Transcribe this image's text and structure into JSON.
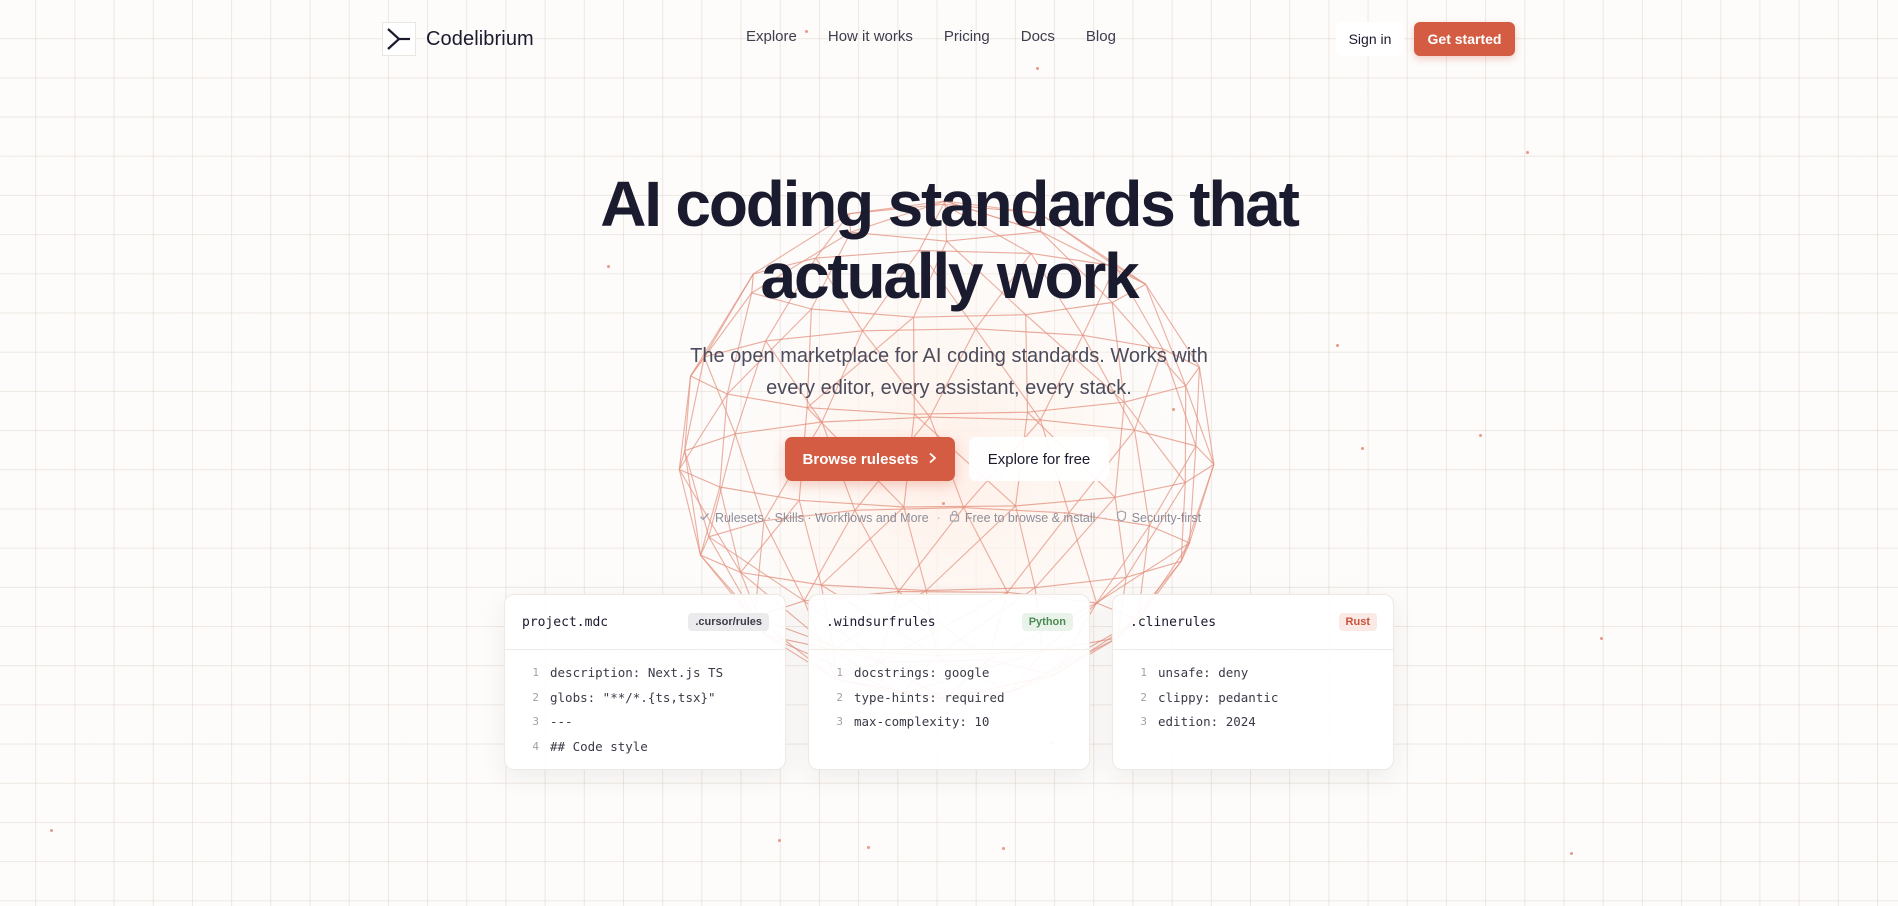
{
  "brand": {
    "name": "Codelibrium",
    "logo_icon": "chevron-bracket-logo"
  },
  "nav": {
    "links": [
      "Explore",
      "How it works",
      "Pricing",
      "Docs",
      "Blog"
    ],
    "signin_label": "Sign in",
    "cta_label": "Get started"
  },
  "hero": {
    "title_line1": "AI coding standards that",
    "title_line2": "actually work",
    "subtitle_line1": "The open marketplace for AI coding standards. Works with",
    "subtitle_line2": "every editor, every assistant, every stack.",
    "primary_cta": "Browse rulesets",
    "secondary_cta": "Explore for free",
    "features": [
      {
        "icon": "check-icon",
        "label": "Rulesets · Skills · Workflows and More"
      },
      {
        "icon": "lock-icon",
        "label": "Free to browse & install"
      },
      {
        "icon": "shield-icon",
        "label": "Security-first"
      }
    ],
    "feature_separator": "·"
  },
  "cards": [
    {
      "file": "project.mdc",
      "badge": ".cursor/rules",
      "badge_colors": {
        "bg": "#ebebed",
        "fg": "#3b3b48"
      },
      "lines": [
        {
          "n": "1",
          "code": "description: Next.js TS"
        },
        {
          "n": "2",
          "code": "globs: \"**/*.{ts,tsx}\""
        },
        {
          "n": "3",
          "code": "---"
        },
        {
          "n": "4",
          "code": "## Code style"
        }
      ]
    },
    {
      "file": ".windsurfrules",
      "badge": "Python",
      "badge_colors": {
        "bg": "#eaf3ea",
        "fg": "#4d8a55"
      },
      "lines": [
        {
          "n": "1",
          "code": "docstrings: google"
        },
        {
          "n": "2",
          "code": "type-hints: required"
        },
        {
          "n": "3",
          "code": "max-complexity: 10"
        }
      ]
    },
    {
      "file": ".clinerules",
      "badge": "Rust",
      "badge_colors": {
        "bg": "#fbe9e5",
        "fg": "#c8523b"
      },
      "lines": [
        {
          "n": "1",
          "code": "unsafe: deny"
        },
        {
          "n": "2",
          "code": "clippy: pedantic"
        },
        {
          "n": "3",
          "code": "edition: 2024"
        }
      ]
    }
  ],
  "colors": {
    "accent": "#d35c42",
    "text": "#1b1b2f",
    "muted": "#8d8d99",
    "sphere_line": "#e3907d"
  }
}
